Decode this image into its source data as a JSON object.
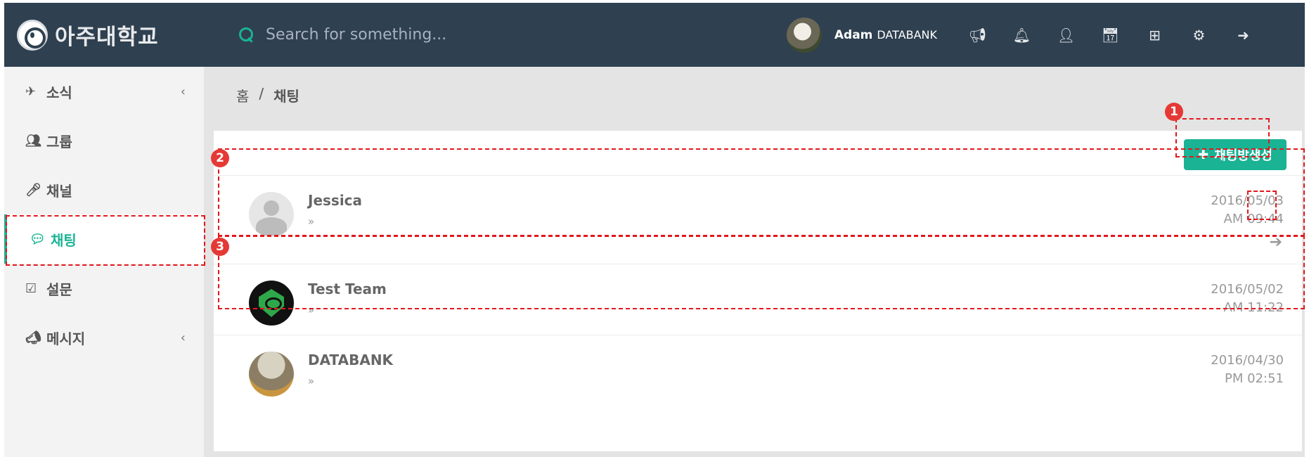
{
  "header": {
    "logo_text": "아주대학교",
    "search_placeholder": "Search for something...",
    "user_name": "Adam",
    "user_org": "DATABANK",
    "icons": [
      "megaphone-icon",
      "bell-icon",
      "user-icon",
      "calendar-icon",
      "grid-icon",
      "gears-icon",
      "sign-out-icon"
    ]
  },
  "sidebar": {
    "items": [
      {
        "label": "소식",
        "icon": "paper-plane-icon",
        "has_chevron": true
      },
      {
        "label": "그룹",
        "icon": "users-icon",
        "has_chevron": false
      },
      {
        "label": "채널",
        "icon": "microphone-icon",
        "has_chevron": false
      },
      {
        "label": "채팅",
        "icon": "comments-icon",
        "has_chevron": false,
        "active": true
      },
      {
        "label": "설문",
        "icon": "check-square-icon",
        "has_chevron": false
      },
      {
        "label": "메시지",
        "icon": "bullhorn-icon",
        "has_chevron": true
      }
    ]
  },
  "breadcrumb": {
    "home": "홈",
    "separator": "/",
    "current": "채팅"
  },
  "create_button": {
    "label": "채팅방생성",
    "icon": "plus-icon"
  },
  "chat_rooms": [
    {
      "name": "Jessica",
      "last_message": "»",
      "date": "2016/05/03",
      "time": "AM 09:44",
      "avatar": "default-user-avatar"
    },
    {
      "name": "Test Team",
      "last_message": "»",
      "date": "2016/05/02",
      "time": "AM 11:22",
      "avatar": "team-logo-avatar"
    },
    {
      "name": "DATABANK",
      "last_message": "»",
      "date": "2016/04/30",
      "time": "PM 02:51",
      "avatar": "group-photo-avatar"
    }
  ],
  "annotations": {
    "badge_1": "1",
    "badge_2": "2",
    "badge_3": "3"
  },
  "colors": {
    "topbar": "#2f4050",
    "accent": "#1ab394",
    "annotation": "#e3171b"
  }
}
